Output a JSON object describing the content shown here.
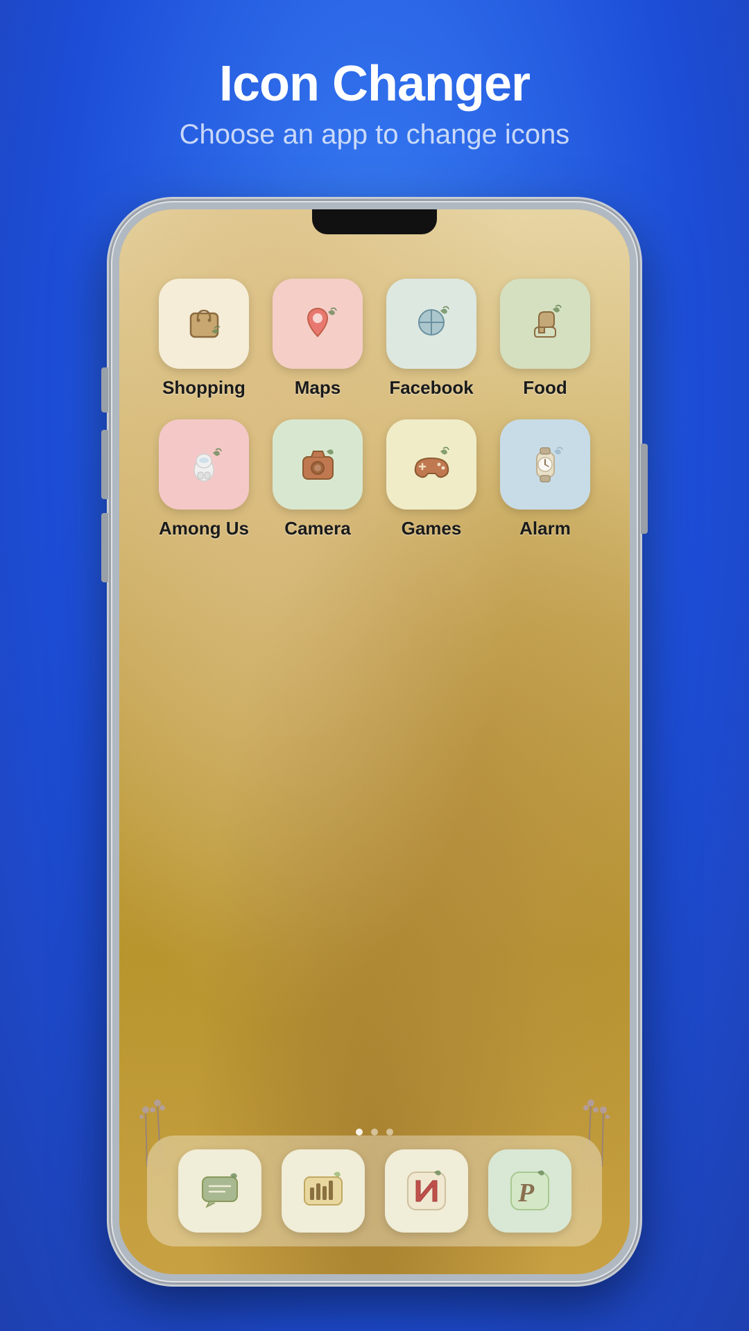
{
  "header": {
    "title": "Icon Changer",
    "subtitle": "Choose an app to change icons"
  },
  "apps": [
    {
      "id": "shopping",
      "label": "Shopping",
      "bg": "icon-shopping",
      "color": "#8b6a3e"
    },
    {
      "id": "maps",
      "label": "Maps",
      "bg": "icon-maps",
      "color": "#c0604a"
    },
    {
      "id": "facebook",
      "label": "Facebook",
      "bg": "icon-facebook",
      "color": "#5a8a6a"
    },
    {
      "id": "food",
      "label": "Food",
      "bg": "icon-food",
      "color": "#7a8a5a"
    },
    {
      "id": "amongus",
      "label": "Among Us",
      "bg": "icon-amongus",
      "color": "#c06060"
    },
    {
      "id": "camera",
      "label": "Camera",
      "bg": "icon-camera",
      "color": "#7a9a6a"
    },
    {
      "id": "games",
      "label": "Games",
      "bg": "icon-games",
      "color": "#a09050"
    },
    {
      "id": "alarm",
      "label": "Alarm",
      "bg": "icon-alarm",
      "color": "#6a8a9a"
    }
  ],
  "dock": [
    {
      "id": "messages",
      "label": "Messages"
    },
    {
      "id": "music",
      "label": "Music"
    },
    {
      "id": "netflix",
      "label": "Netflix"
    },
    {
      "id": "pinterest",
      "label": "Pinterest"
    }
  ]
}
